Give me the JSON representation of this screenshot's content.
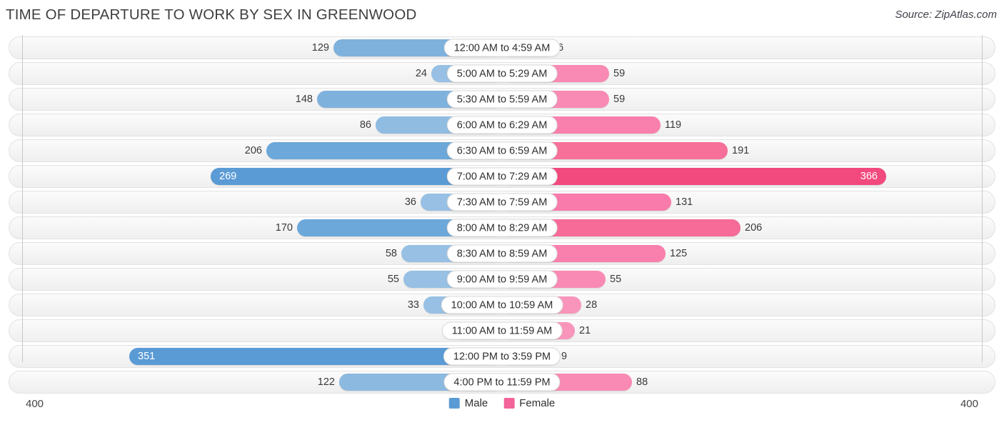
{
  "header": {
    "title": "TIME OF DEPARTURE TO WORK BY SEX IN GREENWOOD",
    "source": "Source: ZipAtlas.com"
  },
  "legend": {
    "items": [
      {
        "label": "Male",
        "color": "#5b9bd5"
      },
      {
        "label": "Female",
        "color": "#f2649a"
      }
    ]
  },
  "axis": {
    "left_max": "400",
    "right_max": "400"
  },
  "chart_data": {
    "type": "bar",
    "orientation": "horizontal-diverging",
    "title": "TIME OF DEPARTURE TO WORK BY SEX IN GREENWOOD",
    "subtitle": "Source: ZipAtlas.com",
    "xlabel": "",
    "ylabel": "",
    "xlim": [
      400,
      400
    ],
    "axis_left_max": 400,
    "axis_right_max": 400,
    "grid": false,
    "legend_position": "bottom-center",
    "categories": [
      "12:00 AM to 4:59 AM",
      "5:00 AM to 5:29 AM",
      "5:30 AM to 5:59 AM",
      "6:00 AM to 6:29 AM",
      "6:30 AM to 6:59 AM",
      "7:00 AM to 7:29 AM",
      "7:30 AM to 7:59 AM",
      "8:00 AM to 8:29 AM",
      "8:30 AM to 8:59 AM",
      "9:00 AM to 9:59 AM",
      "10:00 AM to 10:59 AM",
      "11:00 AM to 11:59 AM",
      "12:00 PM to 3:59 PM",
      "4:00 PM to 11:59 PM"
    ],
    "series": [
      {
        "name": "Male",
        "color": "#5b9bd5",
        "values": [
          129,
          24,
          148,
          86,
          206,
          269,
          36,
          170,
          58,
          55,
          33,
          0,
          351,
          122
        ]
      },
      {
        "name": "Female",
        "color": "#f2649a",
        "values": [
          6,
          59,
          59,
          119,
          191,
          366,
          131,
          206,
          125,
          55,
          28,
          21,
          9,
          88
        ]
      }
    ]
  },
  "rows": [
    {
      "label": "12:00 AM to 4:59 AM",
      "male": "129",
      "female": "6",
      "male_w": 236,
      "female_w": 72,
      "male_shade": "#7fb1dd",
      "female_shade": "#f9a8c6",
      "male_inside": false,
      "female_inside": false
    },
    {
      "label": "5:00 AM to 5:29 AM",
      "male": "24",
      "female": "59",
      "male_w": 99,
      "female_w": 150,
      "male_shade": "#97c0e4",
      "female_shade": "#f88ab3",
      "male_inside": false,
      "female_inside": false
    },
    {
      "label": "5:30 AM to 5:59 AM",
      "male": "148",
      "female": "59",
      "male_w": 259,
      "female_w": 150,
      "male_shade": "#7fb1dd",
      "female_shade": "#f88ab3",
      "male_inside": false,
      "female_inside": false
    },
    {
      "label": "6:00 AM to 6:29 AM",
      "male": "86",
      "female": "119",
      "male_w": 177,
      "female_w": 222,
      "male_shade": "#90bce2",
      "female_shade": "#f97fac",
      "male_inside": false,
      "female_inside": false
    },
    {
      "label": "6:30 AM to 6:59 AM",
      "male": "206",
      "female": "191",
      "male_w": 330,
      "female_w": 316,
      "male_shade": "#6ca8d9",
      "female_shade": "#f77099",
      "male_inside": false,
      "female_inside": false
    },
    {
      "label": "7:00 AM to 7:29 AM",
      "male": "269",
      "female": "366",
      "male_w": 408,
      "female_w": 538,
      "male_shade": "#5b9bd5",
      "female_shade": "#f2497f",
      "male_inside": true,
      "female_inside": true
    },
    {
      "label": "7:30 AM to 7:59 AM",
      "male": "36",
      "female": "131",
      "male_w": 114,
      "female_w": 237,
      "male_shade": "#97c0e4",
      "female_shade": "#f97bab",
      "male_inside": false,
      "female_inside": false
    },
    {
      "label": "8:00 AM to 8:29 AM",
      "male": "170",
      "female": "206",
      "male_w": 287,
      "female_w": 334,
      "male_shade": "#6ca8d9",
      "female_shade": "#f66b97",
      "male_inside": false,
      "female_inside": false
    },
    {
      "label": "8:30 AM to 8:59 AM",
      "male": "58",
      "female": "125",
      "male_w": 141,
      "female_w": 229,
      "male_shade": "#97c0e4",
      "female_shade": "#f97fac",
      "male_inside": false,
      "female_inside": false
    },
    {
      "label": "9:00 AM to 9:59 AM",
      "male": "55",
      "female": "55",
      "male_w": 138,
      "female_w": 145,
      "male_shade": "#97c0e4",
      "female_shade": "#f88ab3",
      "male_inside": false,
      "female_inside": false
    },
    {
      "label": "10:00 AM to 10:59 AM",
      "male": "33",
      "female": "28",
      "male_w": 110,
      "female_w": 111,
      "male_shade": "#97c0e4",
      "female_shade": "#f995bb",
      "male_inside": false,
      "female_inside": false
    },
    {
      "label": "11:00 AM to 11:59 AM",
      "male": "0",
      "female": "21",
      "male_w": 69,
      "female_w": 102,
      "male_shade": "#9ec5e7",
      "female_shade": "#f995bb",
      "male_inside": false,
      "female_inside": false
    },
    {
      "label": "12:00 PM to 3:59 PM",
      "male": "351",
      "female": "9",
      "male_w": 522,
      "female_w": 77,
      "male_shade": "#5b9bd5",
      "female_shade": "#f9a8c6",
      "male_inside": true,
      "female_inside": false
    },
    {
      "label": "4:00 PM to 11:59 PM",
      "male": "122",
      "female": "88",
      "male_w": 228,
      "female_w": 182,
      "male_shade": "#8cb9e0",
      "female_shade": "#f88ab3",
      "male_inside": false,
      "female_inside": false
    }
  ]
}
